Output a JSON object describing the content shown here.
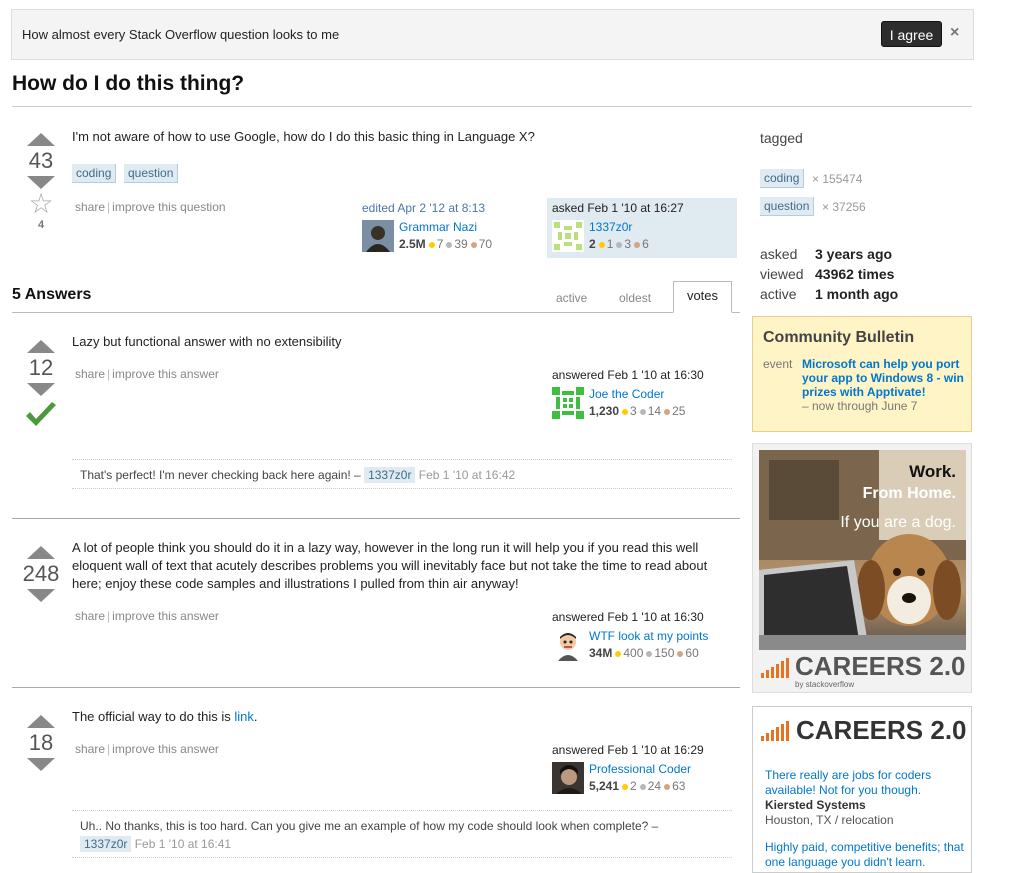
{
  "banner": {
    "text": "How almost every Stack Overflow question looks to me",
    "agree_label": "I agree",
    "close_label": "×"
  },
  "question": {
    "title": "How do I do this thing?",
    "votes": "43",
    "favorites": "4",
    "body": "I'm not aware of how to use Google, how do I do this basic thing in Language X?",
    "tags": [
      "coding",
      "question"
    ],
    "menu": {
      "share": "share",
      "sep": "|",
      "improve": "improve this question"
    },
    "edited": {
      "action": "edited Apr 2 '12 at 8:13",
      "user": "Grammar Nazi",
      "rep": "2.5M",
      "gold": "7",
      "silver": "39",
      "bronze": "70"
    },
    "asked": {
      "action": "asked Feb 1 '10 at 16:27",
      "user": "1337z0r",
      "rep": "2",
      "gold": "1",
      "silver": "3",
      "bronze": "6"
    }
  },
  "answers_header": "5 Answers",
  "tabs": {
    "active": "active",
    "oldest": "oldest",
    "votes": "votes"
  },
  "answers": [
    {
      "votes": "12",
      "body": "Lazy but functional answer with no extensibility",
      "menu": {
        "share": "share",
        "sep": "|",
        "improve": "improve this answer"
      },
      "sig": {
        "action": "answered Feb 1 '10 at 16:30",
        "user": "Joe the Coder",
        "rep": "1,230",
        "gold": "3",
        "silver": "14",
        "bronze": "25"
      },
      "comment": {
        "text": "That's perfect! I'm never checking back here again! –",
        "user": "1337z0r",
        "date": "Feb 1 '10 at 16:42"
      }
    },
    {
      "votes": "248",
      "body": "A lot of people think you should do it in a lazy way, however in the long run it will help you if you read this well eloquent wall of text that acutely describes problems you will inevitably face but not take the time to read about here; enjoy these code samples and illustrations I pulled from thin air anyway!",
      "menu": {
        "share": "share",
        "sep": "|",
        "improve": "improve this answer"
      },
      "sig": {
        "action": "answered Feb 1 '10 at 16:30",
        "user": "WTF look at my points",
        "rep": "34M",
        "gold": "400",
        "silver": "150",
        "bronze": "60"
      }
    },
    {
      "votes": "18",
      "body_prefix": "The official way to do this is ",
      "body_link": "link",
      "body_suffix": ".",
      "menu": {
        "share": "share",
        "sep": "|",
        "improve": "improve this answer"
      },
      "sig": {
        "action": "answered Feb 1 '10 at 16:29",
        "user": "Professional Coder",
        "rep": "5,241",
        "gold": "2",
        "silver": "24",
        "bronze": "63"
      },
      "comment": {
        "text": "Uh.. No thanks, this is too hard. Can you give me an example of how my code should look when complete? –",
        "user": "1337z0r",
        "date": "Feb 1 '10 at 16:41"
      }
    }
  ],
  "sidebar": {
    "tagged_label": "tagged",
    "tags": [
      {
        "name": "coding",
        "count": "× 155474"
      },
      {
        "name": "question",
        "count": "× 37256"
      }
    ],
    "stats": [
      {
        "label": "asked",
        "value": "3 years ago"
      },
      {
        "label": "viewed",
        "value": "43962 times"
      },
      {
        "label": "active",
        "value": "1 month ago"
      }
    ],
    "bulletin": {
      "title": "Community Bulletin",
      "event_label": "event",
      "event_text": "Microsoft can help you port your app to Windows 8 - win prizes with Apptivate!",
      "event_sub": "– now through June 7"
    },
    "ad1": {
      "line1": "Work.",
      "line2": "From Home.",
      "line3": "If you are a dog.",
      "brand": "CAREERS 2.0",
      "by": "by stackoverflow"
    },
    "ad2": {
      "brand": "CAREERS 2.0",
      "job1": "There really are jobs for coders available! Not for you though.",
      "company1": "Kiersted Systems",
      "location1": "Houston, TX / relocation",
      "job2": "Highly paid, competitive benefits; that one language you didn't learn."
    }
  },
  "colors": {
    "link": "#0077cc",
    "tag_bg": "#e0eaf1",
    "accept": "#4a9a3c",
    "bulletin_bg": "#fff4c5",
    "careers_orange": "#e8731e"
  }
}
